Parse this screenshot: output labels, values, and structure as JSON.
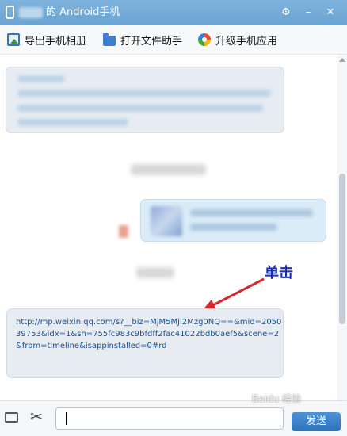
{
  "window": {
    "title": "的 Android手机"
  },
  "toolbar": {
    "items": [
      {
        "label": "导出手机相册",
        "icon": "export-photo-icon"
      },
      {
        "label": "打开文件助手",
        "icon": "folder-icon"
      },
      {
        "label": "升级手机应用",
        "icon": "upgrade-app-icon"
      }
    ]
  },
  "chat": {
    "link_message": "http://mp.weixin.qq.com/s?__biz=MjM5MjI2Mzg0NQ==&mid=205039753&idx=1&sn=755fc983c9bfdff2fac41022bdb0aef5&scene=2&from=timeline&isappinstalled=0#rd",
    "annotation": "单击"
  },
  "input": {
    "value": ""
  },
  "send_button": {
    "label": "发送"
  },
  "watermark": "Baidu 经验",
  "colors": {
    "titlebar": "#6aa3d2",
    "link_text": "#1f4f8c",
    "annotation": "#1a2db4",
    "arrow": "#d9262b",
    "send_button": "#2f73bb"
  }
}
